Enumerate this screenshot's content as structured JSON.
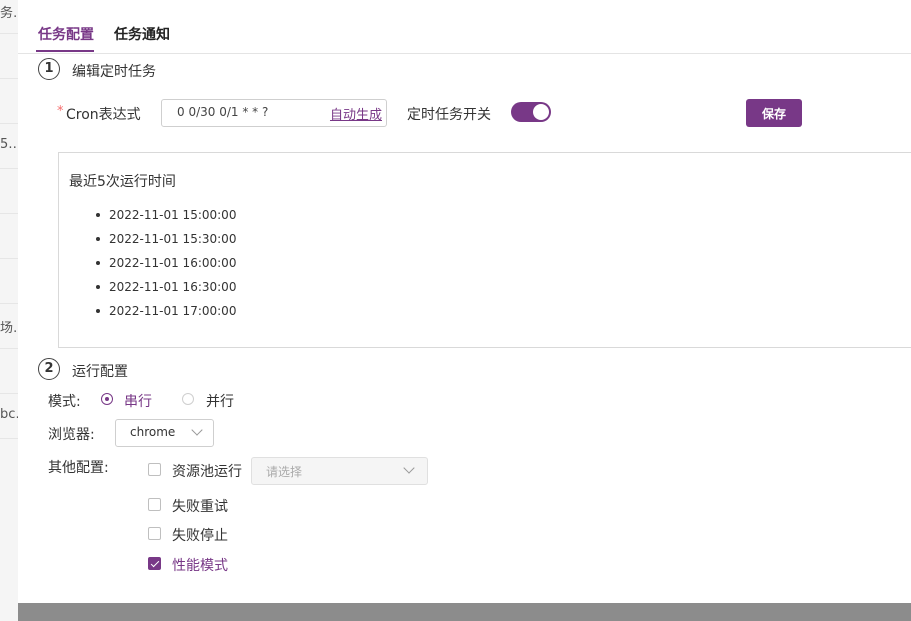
{
  "background": {
    "rows": [
      "务…",
      "5…",
      "场…",
      "bc…"
    ]
  },
  "tabs": [
    {
      "label": "任务配置",
      "active": true
    },
    {
      "label": "任务通知",
      "active": false
    }
  ],
  "section1": {
    "number": "1",
    "title": "编辑定时任务",
    "cron": {
      "required_mark": "*",
      "label": "Cron表达式",
      "value": "0 0/30 0/1 * * ?",
      "auto_generate": "自动生成"
    },
    "schedule_switch": {
      "label": "定时任务开关",
      "on": true
    },
    "save_label": "保存",
    "recent_runs": {
      "title": "最近5次运行时间",
      "items": [
        "2022-11-01 15:00:00",
        "2022-11-01 15:30:00",
        "2022-11-01 16:00:00",
        "2022-11-01 16:30:00",
        "2022-11-01 17:00:00"
      ]
    }
  },
  "section2": {
    "number": "2",
    "title": "运行配置",
    "mode": {
      "label": "模式:",
      "options": [
        {
          "label": "串行",
          "selected": true
        },
        {
          "label": "并行",
          "selected": false
        }
      ]
    },
    "browser": {
      "label": "浏览器:",
      "value": "chrome"
    },
    "other": {
      "label": "其他配置:",
      "resource_pool": {
        "label": "资源池运行",
        "checked": false,
        "placeholder": "请选择"
      },
      "retry_on_fail": {
        "label": "失败重试",
        "checked": false
      },
      "stop_on_fail": {
        "label": "失败停止",
        "checked": false
      },
      "performance_mode": {
        "label": "性能模式",
        "checked": true
      }
    }
  },
  "colors": {
    "accent": "#783887",
    "required": "#f56c6c",
    "overlay": "#8c8c8c"
  }
}
